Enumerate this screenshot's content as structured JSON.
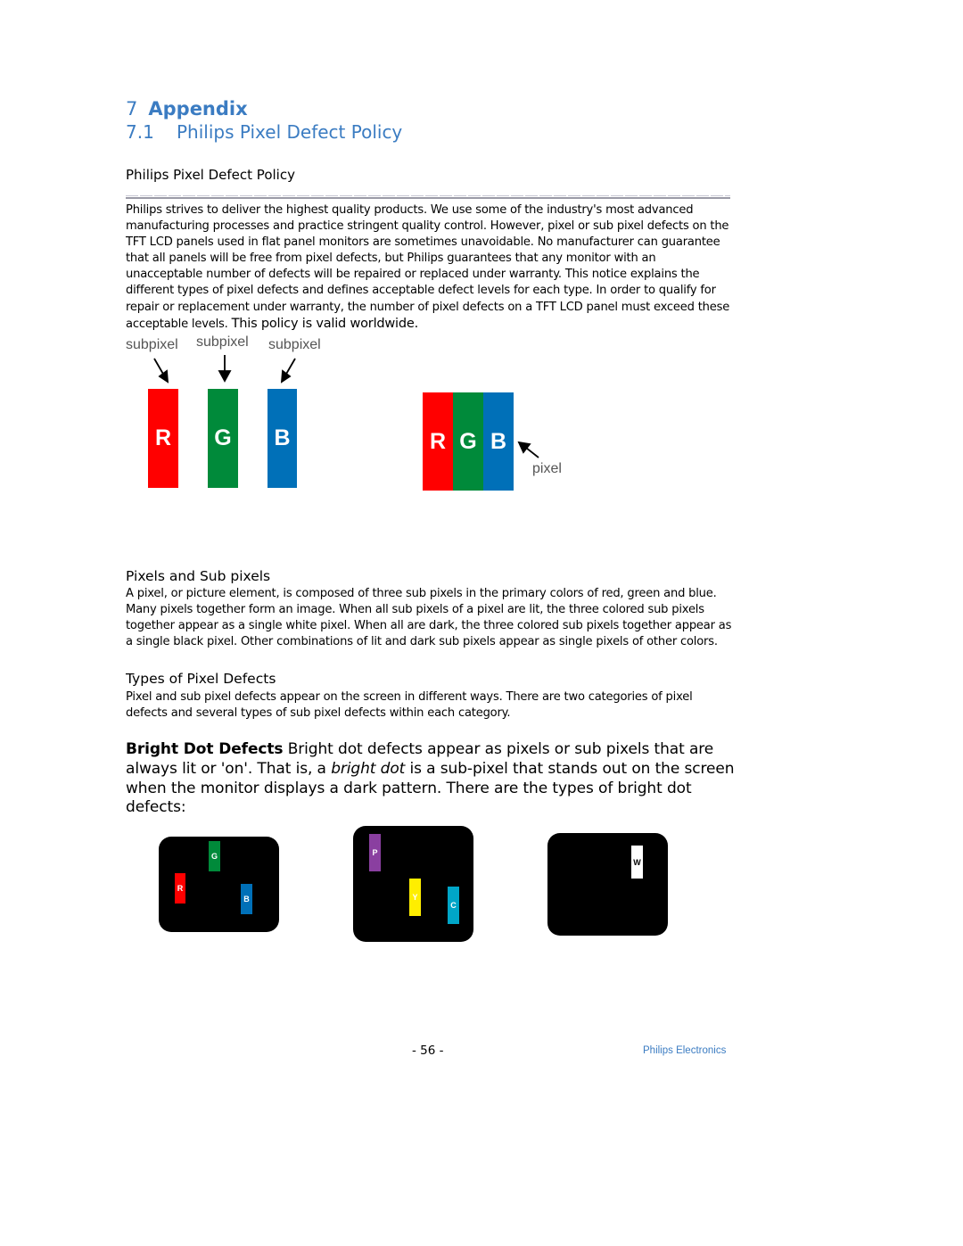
{
  "headings": {
    "chapter_number": "7",
    "chapter_title": "Appendix",
    "section_number": "7.1",
    "section_title": "Philips Pixel Defect Policy"
  },
  "policy_title": "Philips Pixel Defect Policy",
  "intro": {
    "text": "Philips strives to deliver the highest quality products. We use some of the industry's most advanced manufacturing processes and practice stringent quality control. However, pixel or sub pixel defects on the TFT LCD panels used in flat panel monitors are sometimes unavoidable. No manufacturer can guarantee that all panels will be free from pixel defects, but Philips guarantees that any monitor with an unacceptable number of defects will be repaired or replaced under warranty. This notice explains the different types of pixel defects and defines acceptable defect levels for each type. In order to qualify for repair or replacement under warranty, the number of pixel defects on a TFT LCD panel must exceed these acceptable levels.",
    "emphasis": "This policy is valid worldwide."
  },
  "diagram_subpixels": {
    "labels": [
      "subpixel",
      "subpixel",
      "subpixel"
    ],
    "bars": [
      {
        "letter": "R",
        "color": "#ff0000"
      },
      {
        "letter": "G",
        "color": "#008a3a"
      },
      {
        "letter": "B",
        "color": "#0070b8"
      }
    ]
  },
  "diagram_pixel": {
    "letters": [
      "R",
      "G",
      "B"
    ],
    "colors": [
      "#ff0000",
      "#008a3a",
      "#0070b8"
    ],
    "label": "pixel"
  },
  "pixels_section": {
    "heading": "Pixels and Sub pixels",
    "text": "A pixel, or picture element, is composed of three sub pixels in the primary colors of red, green and blue. Many pixels together form an image. When all sub pixels of a pixel are lit, the three colored sub pixels together appear as a single white pixel. When all are dark, the three colored sub pixels together appear as a single black pixel. Other combinations of lit and dark sub pixels appear as single pixels of other colors."
  },
  "types_section": {
    "heading": "Types of Pixel Defects",
    "text": "Pixel and sub pixel defects appear on the screen in different ways. There are two categories of pixel defects and several types of sub pixel defects within each category."
  },
  "bright_dot": {
    "title": "Bright Dot Defects",
    "text_1": " Bright dot defects appear as pixels or sub pixels that are always lit or 'on'. That is, a ",
    "italic": "bright dot",
    "text_2": " is a sub-pixel that stands out on the screen when the monitor displays a dark pattern. There are the types of bright dot defects:"
  },
  "defect_panels": [
    {
      "dots": [
        {
          "letter": "G",
          "color": "#008a3a"
        },
        {
          "letter": "R",
          "color": "#ff0000"
        },
        {
          "letter": "B",
          "color": "#0070b8"
        }
      ]
    },
    {
      "dots": [
        {
          "letter": "P",
          "color": "#8a3fa0"
        },
        {
          "letter": "Y",
          "color": "#ffee00"
        },
        {
          "letter": "C",
          "color": "#00a6c8"
        }
      ]
    },
    {
      "dots": [
        {
          "letter": "W",
          "color": "#ffffff"
        }
      ]
    }
  ],
  "footer": {
    "page": "- 56 -",
    "brand": "Philips Electronics"
  }
}
